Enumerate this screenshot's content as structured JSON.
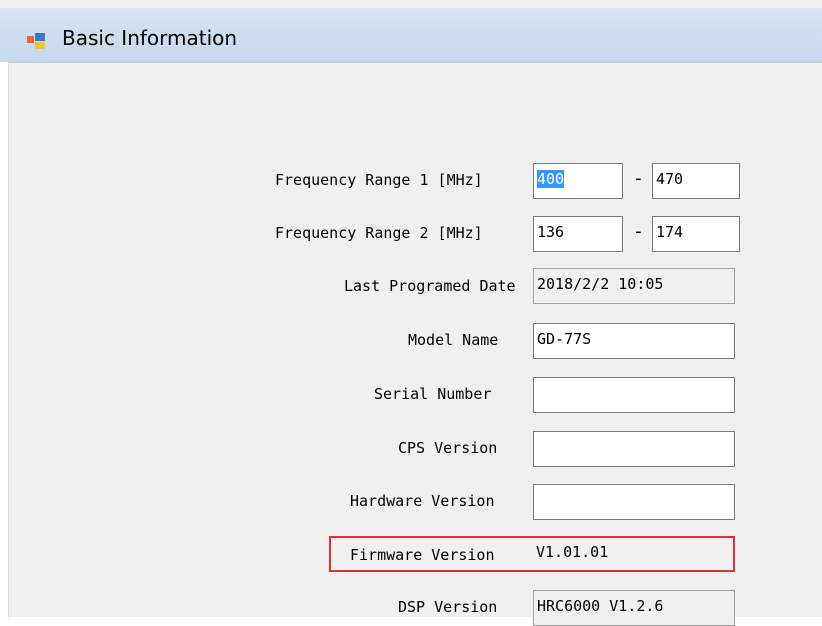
{
  "window": {
    "title": "Basic Information",
    "icon": "form-icon"
  },
  "fields": {
    "freq1": {
      "label": "Frequency Range 1 [MHz]",
      "low": "400",
      "high": "470",
      "separator": "-"
    },
    "freq2": {
      "label": "Frequency Range 2 [MHz]",
      "low": "136",
      "high": "174",
      "separator": "-"
    },
    "last_programmed": {
      "label": "Last Programed Date",
      "value": "2018/2/2 10:05"
    },
    "model_name": {
      "label": "Model Name",
      "value": "GD-77S"
    },
    "serial_number": {
      "label": "Serial Number",
      "value": ""
    },
    "cps_version": {
      "label": "CPS Version",
      "value": ""
    },
    "hardware_version": {
      "label": "Hardware Version",
      "value": ""
    },
    "firmware_version": {
      "label": "Firmware Version",
      "value": "V1.01.01"
    },
    "dsp_version": {
      "label": "DSP Version",
      "value": "HRC6000 V1.2.6"
    }
  },
  "colors": {
    "highlight": "#e0303a",
    "selection": "#3399ff",
    "titlebar": "#c6d8ec"
  }
}
